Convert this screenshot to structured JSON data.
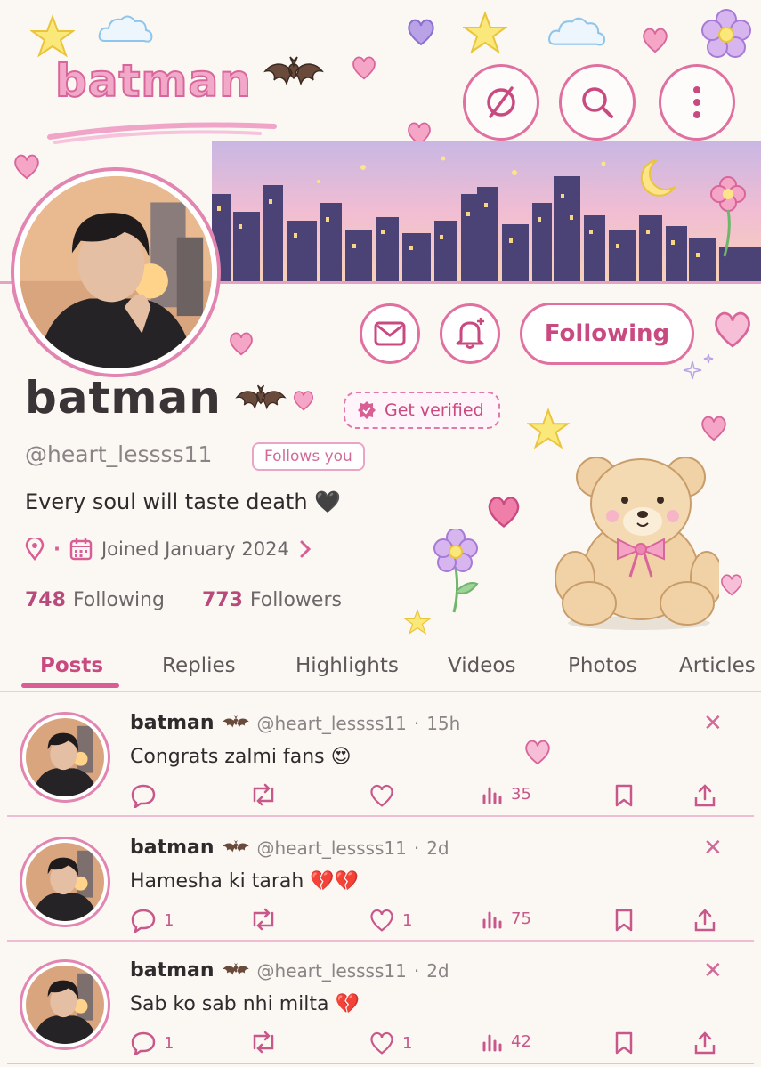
{
  "header": {
    "title": "batman",
    "buttons": [
      {
        "icon": "slashed-circle-icon"
      },
      {
        "icon": "search-icon"
      },
      {
        "icon": "more-vertical-icon"
      }
    ]
  },
  "profile": {
    "display_name": "batman",
    "handle": "@heart_lessss11",
    "follows_you_label": "Follows you",
    "verify_label": "Get verified",
    "bio": "Every soul will taste death 🖤",
    "meta_separator": "·",
    "joined": "Joined January 2024",
    "following_count": "748",
    "following_label": "Following",
    "followers_count": "773",
    "followers_label": "Followers",
    "follow_button_label": "Following",
    "accent_color": "#d95e95"
  },
  "tabs": [
    {
      "label": "Posts",
      "active": true
    },
    {
      "label": "Replies",
      "active": false
    },
    {
      "label": "Highlights",
      "active": false
    },
    {
      "label": "Videos",
      "active": false
    },
    {
      "label": "Photos",
      "active": false
    },
    {
      "label": "Articles",
      "active": false
    }
  ],
  "posts": [
    {
      "name": "batman",
      "handle": "@heart_lessss11",
      "dot": "·",
      "time": "15h",
      "text": "Congrats zalmi fans 😍",
      "replies": "",
      "likes": "",
      "views": "35"
    },
    {
      "name": "batman",
      "handle": "@heart_lessss11",
      "dot": "·",
      "time": "2d",
      "text": "Hamesha ki tarah 💔💔",
      "replies": "1",
      "likes": "1",
      "views": "75"
    },
    {
      "name": "batman",
      "handle": "@heart_lessss11",
      "dot": "·",
      "time": "2d",
      "text": "Sab ko sab nhi milta 💔",
      "replies": "1",
      "likes": "1",
      "views": "42"
    }
  ]
}
